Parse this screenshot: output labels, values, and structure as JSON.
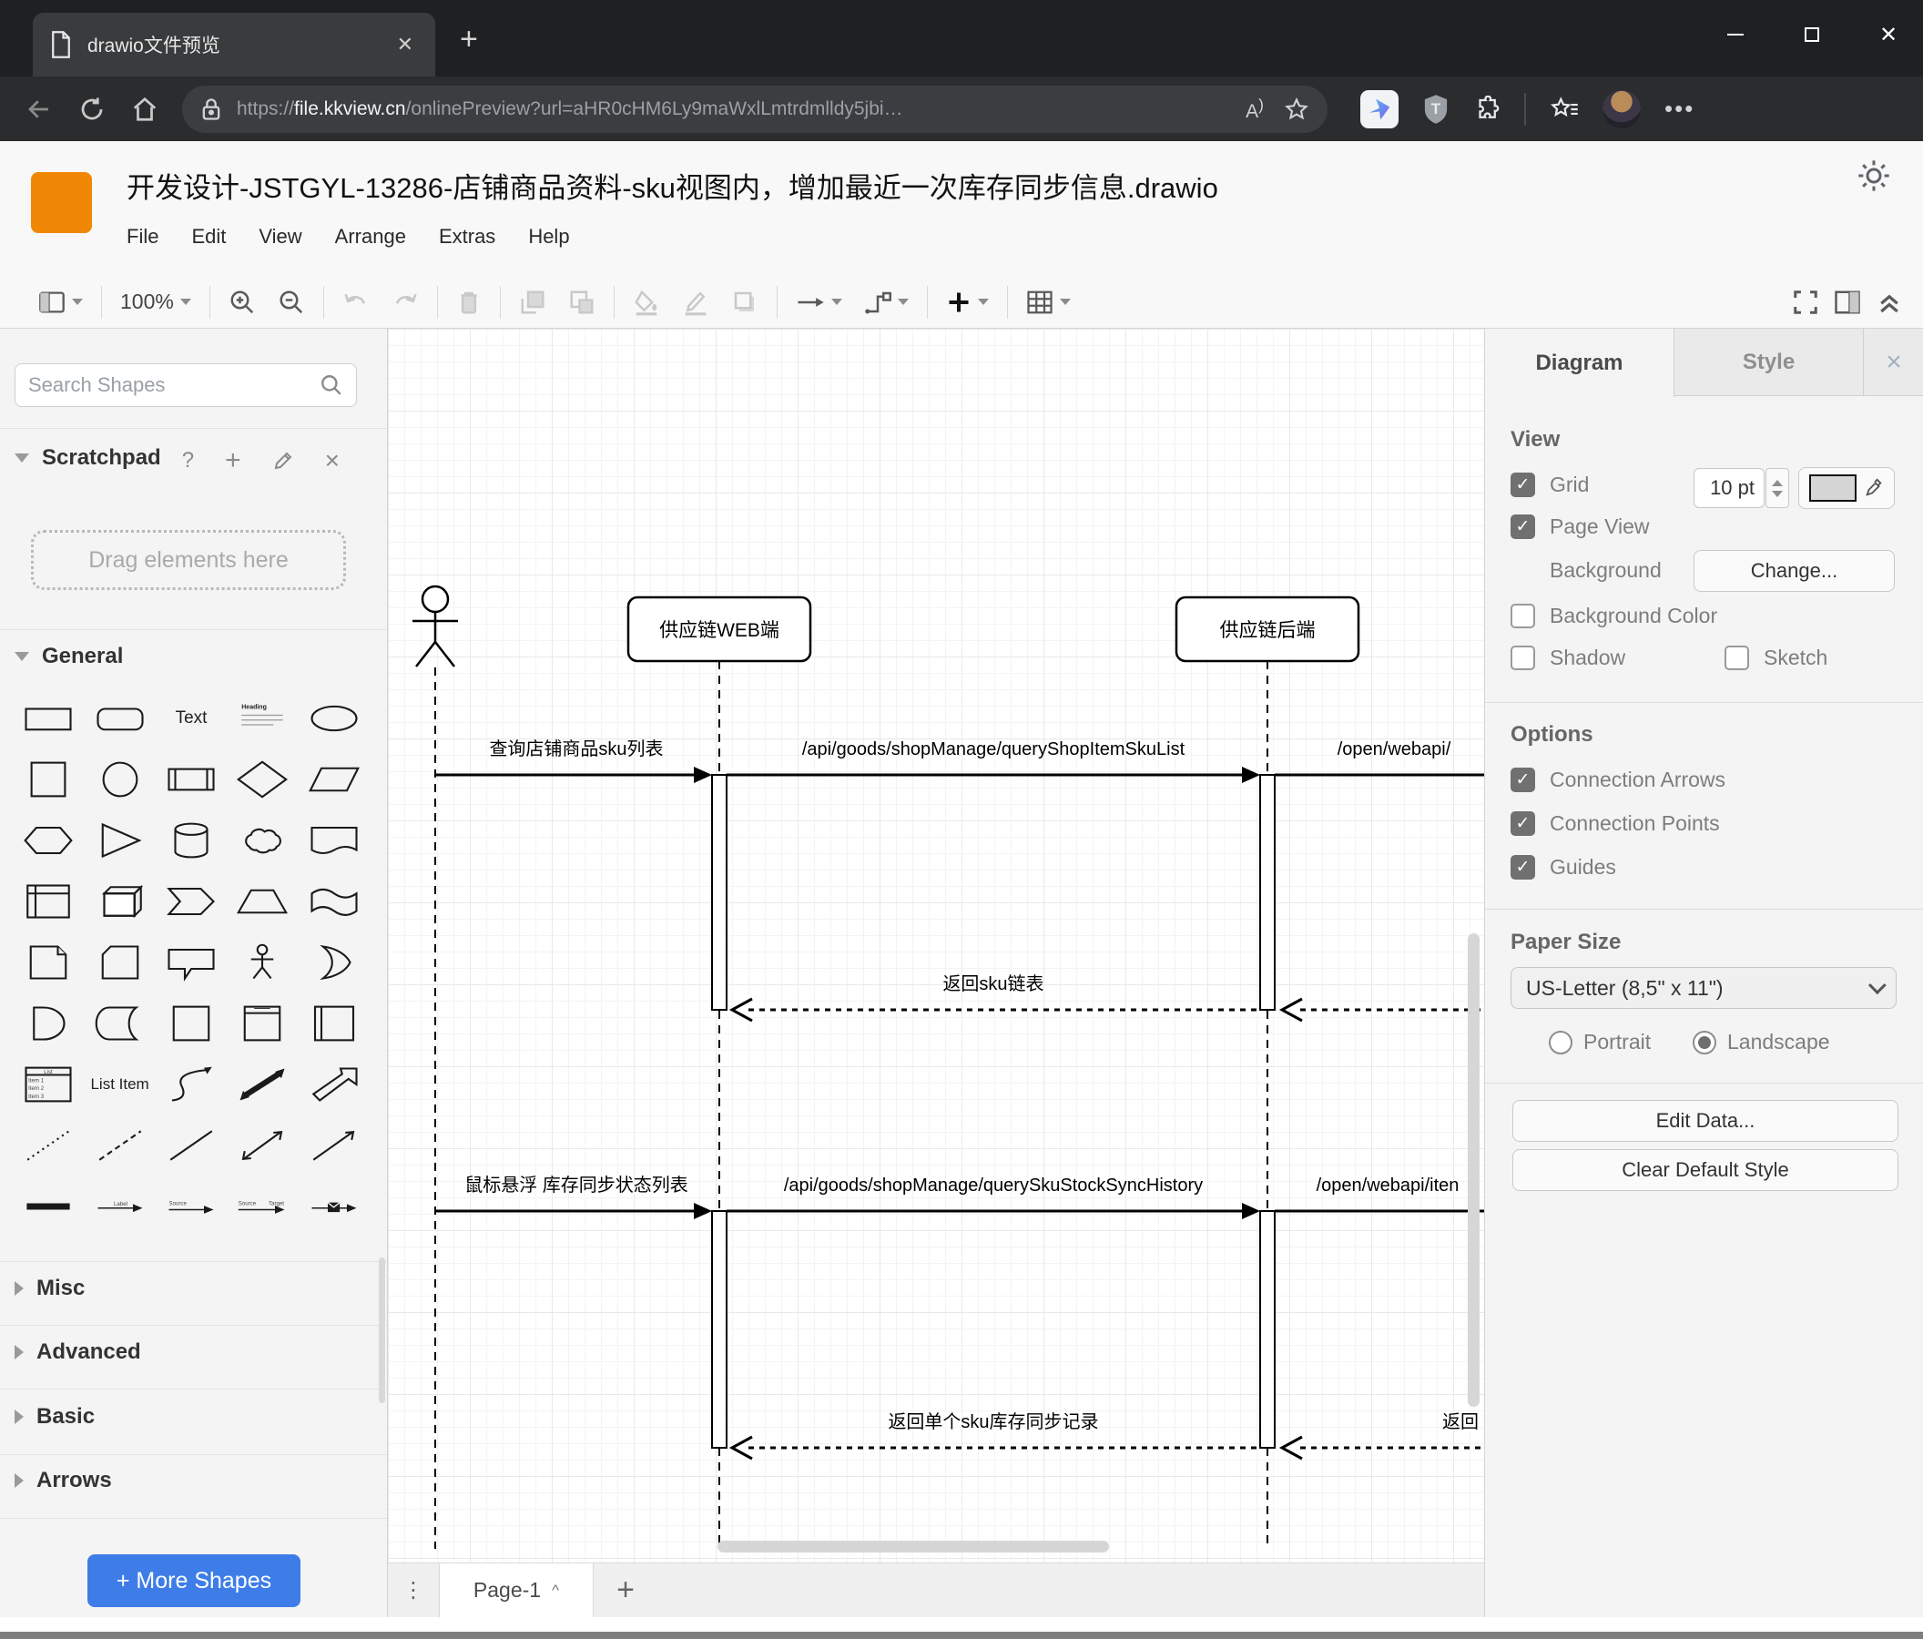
{
  "browser": {
    "tab_title": "drawio文件预览",
    "url": {
      "scheme": "https://",
      "host": "file.kkview.cn",
      "path": "/onlinePreview?url=aHR0cHM6Ly9maWxlLmtrdmlldy5jbi…"
    },
    "read_aloud_label": "A"
  },
  "app": {
    "title": "开发设计-JSTGYL-13286-店铺商品资料-sku视图内，增加最近一次库存同步信息.drawio",
    "menus": [
      "File",
      "Edit",
      "View",
      "Arrange",
      "Extras",
      "Help"
    ]
  },
  "toolbar": {
    "zoom": "100%"
  },
  "sidebar": {
    "search_placeholder": "Search Shapes",
    "scratchpad": {
      "title": "Scratchpad",
      "help": "?",
      "drop_hint": "Drag elements here"
    },
    "sections": {
      "general": "General",
      "misc": "Misc",
      "advanced": "Advanced",
      "basic": "Basic",
      "arrows": "Arrows"
    },
    "palette_labels": {
      "text": "Text",
      "heading": "Heading",
      "list_item": "List Item",
      "list_title": "List",
      "item1": "Item 1",
      "item2": "Item 2",
      "item3": "Item 3",
      "label": "Label",
      "source": "Source",
      "target": "Target"
    },
    "palette_shapes": [
      "rectangle",
      "rounded-rectangle",
      "text",
      "textbox",
      "ellipse",
      "square",
      "circle",
      "process",
      "diamond",
      "parallelogram",
      "hexagon",
      "triangle",
      "cylinder",
      "cloud",
      "document",
      "internal-storage",
      "cube",
      "step",
      "trapezoid",
      "tape",
      "note",
      "card",
      "callout",
      "actor",
      "or",
      "and",
      "data-storage",
      "container",
      "vertical-container",
      "horizontal-container",
      "list",
      "list-item",
      "curve",
      "bidirectional-arrow",
      "block-arrow",
      "dotted-line",
      "dashed-line",
      "line",
      "bidirectional-connector",
      "directional-connector",
      "link",
      "arrow-with-label",
      "source-arrow",
      "source-target-arrow",
      "connector-with-symbol"
    ],
    "more_shapes": "+ More Shapes"
  },
  "diagram": {
    "lifelines": [
      "供应链WEB端",
      "供应链后端"
    ],
    "messages": {
      "m1": "查询店铺商品sku列表",
      "m2": "/api/goods/shopManage/queryShopItemSkuList",
      "m3": "/open/webapi/",
      "r1": "返回sku链表",
      "m4": "鼠标悬浮 库存同步状态列表",
      "m5": "/api/goods/shopManage/querySkuStockSyncHistory",
      "m6": "/open/webapi/iten",
      "r2": "返回单个sku库存同步记录",
      "r3": "返回"
    }
  },
  "panel": {
    "tabs": {
      "diagram": "Diagram",
      "style": "Style"
    },
    "view": {
      "heading": "View",
      "grid": "Grid",
      "grid_size": "10 pt",
      "page_view": "Page View",
      "background": "Background",
      "change": "Change...",
      "background_color": "Background Color",
      "shadow": "Shadow",
      "sketch": "Sketch"
    },
    "options": {
      "heading": "Options",
      "connection_arrows": "Connection Arrows",
      "connection_points": "Connection Points",
      "guides": "Guides"
    },
    "paper": {
      "heading": "Paper Size",
      "value": "US-Letter (8,5\" x 11\")",
      "portrait": "Portrait",
      "landscape": "Landscape"
    },
    "buttons": {
      "edit_data": "Edit Data...",
      "clear_default": "Clear Default Style"
    },
    "states": {
      "grid": true,
      "page_view": true,
      "background_color": false,
      "shadow": false,
      "sketch": false,
      "connection_arrows": true,
      "connection_points": true,
      "guides": true,
      "orientation": "landscape"
    }
  },
  "pagebar": {
    "page": "Page-1"
  },
  "colors": {
    "accent_blue": "#3e7de8",
    "logo_orange": "#F08705",
    "checkbox_gray": "#707070",
    "chrome_dark": "#1f2021"
  }
}
